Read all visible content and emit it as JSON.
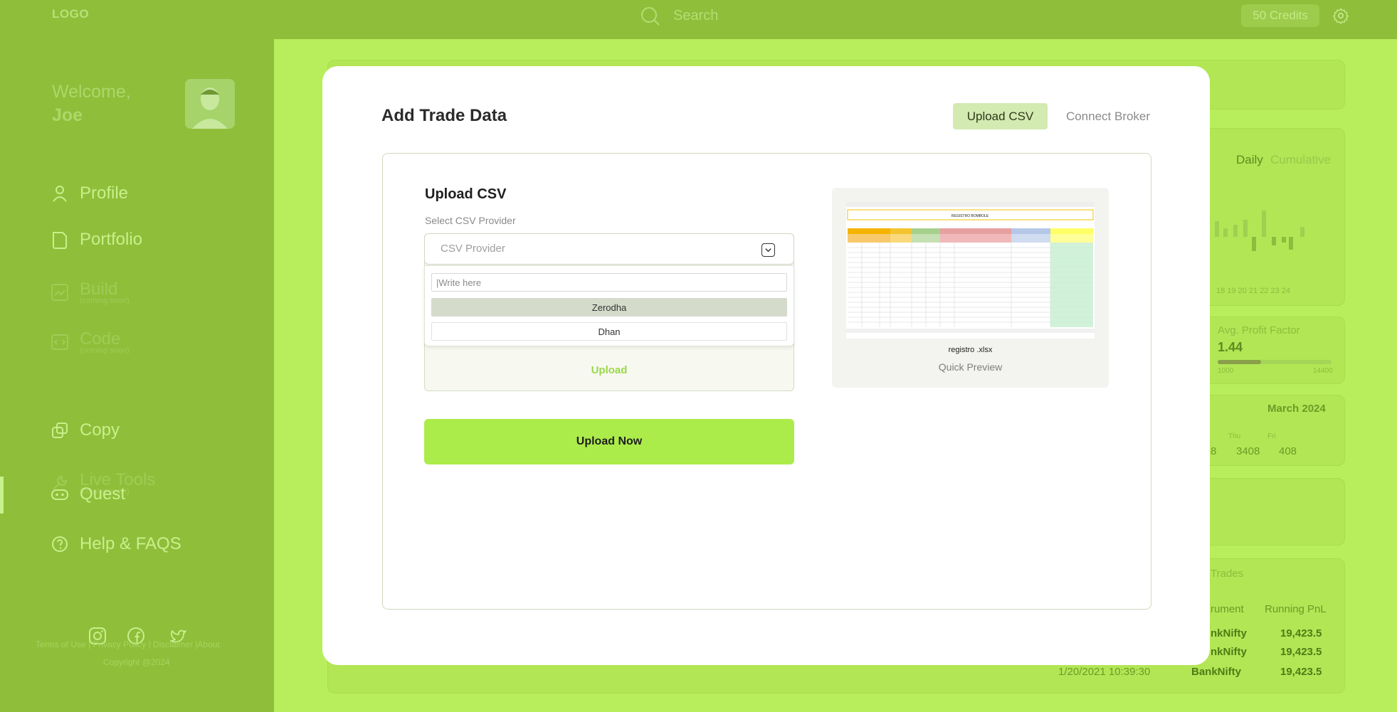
{
  "topbar": {
    "logo": "LOGO",
    "search_placeholder": "Search",
    "credits": "50 Credits"
  },
  "sidebar": {
    "welcome": "Welcome,",
    "user_name": "Joe",
    "items": [
      {
        "label": "Profile",
        "icon": "user-icon"
      },
      {
        "label": "Portfolio",
        "icon": "document-icon"
      },
      {
        "label": "Build",
        "sub": "(coming soon)",
        "icon": "chart-icon"
      },
      {
        "label": "Code",
        "sub": "(coming soon)",
        "icon": "code-icon"
      },
      {
        "label": "Copy",
        "icon": "copy-icon"
      },
      {
        "label": "Live Tools",
        "sub": "(coming soon)",
        "icon": "wrench-icon"
      },
      {
        "label": "Quest",
        "icon": "gamepad-icon"
      },
      {
        "label": "Help & FAQS",
        "icon": "help-icon"
      }
    ],
    "footer_links": "Terms of Use | Privacy Policy | Disclaimer |About",
    "copyright": "Copyright @2024"
  },
  "background": {
    "daily": "Daily",
    "cumulative": "Cumulative",
    "ticks": "18  19  20  21  22  23  24",
    "avg_profit_factor_label": "Avg. Profit Factor",
    "avg_profit_factor_value": "1.44",
    "range_min": "1000",
    "range_max": "14400",
    "month": "March 2024",
    "thu": "Thu",
    "fri": "Fri",
    "val_partial": "8",
    "val_thu": "3408",
    "val_fri": "408",
    "trades_title": "Trades",
    "col_instrument": "rument",
    "col_running_pnl": "Running PnL",
    "rows": [
      {
        "instrument": "nkNifty",
        "pnl": "19,423.5"
      },
      {
        "instrument": "nkNifty",
        "pnl": "19,423.5"
      },
      {
        "date": "1/20/2021 10:39:30",
        "instrument": "BankNifty",
        "pnl": "19,423.5"
      }
    ]
  },
  "modal": {
    "title": "Add Trade Data",
    "tab_upload": "Upload CSV",
    "tab_broker": "Connect Broker",
    "upload_heading": "Upload CSV",
    "select_label": "Select CSV Provider",
    "provider_placeholder": "CSV Provider",
    "dropdown_search_placeholder": "|Write here",
    "options": [
      "Zerodha",
      "Dhan"
    ],
    "upload_link": "Upload",
    "upload_now": "Upload Now",
    "preview_file": "registro .xlsx",
    "preview_label": "Quick Preview",
    "sheet_title": "REGISTRO BOMBOLE"
  },
  "colors": {
    "accent": "#acec4a",
    "sidebar": "#8fbe3a",
    "overlay_bg": "#b8ee5c"
  }
}
